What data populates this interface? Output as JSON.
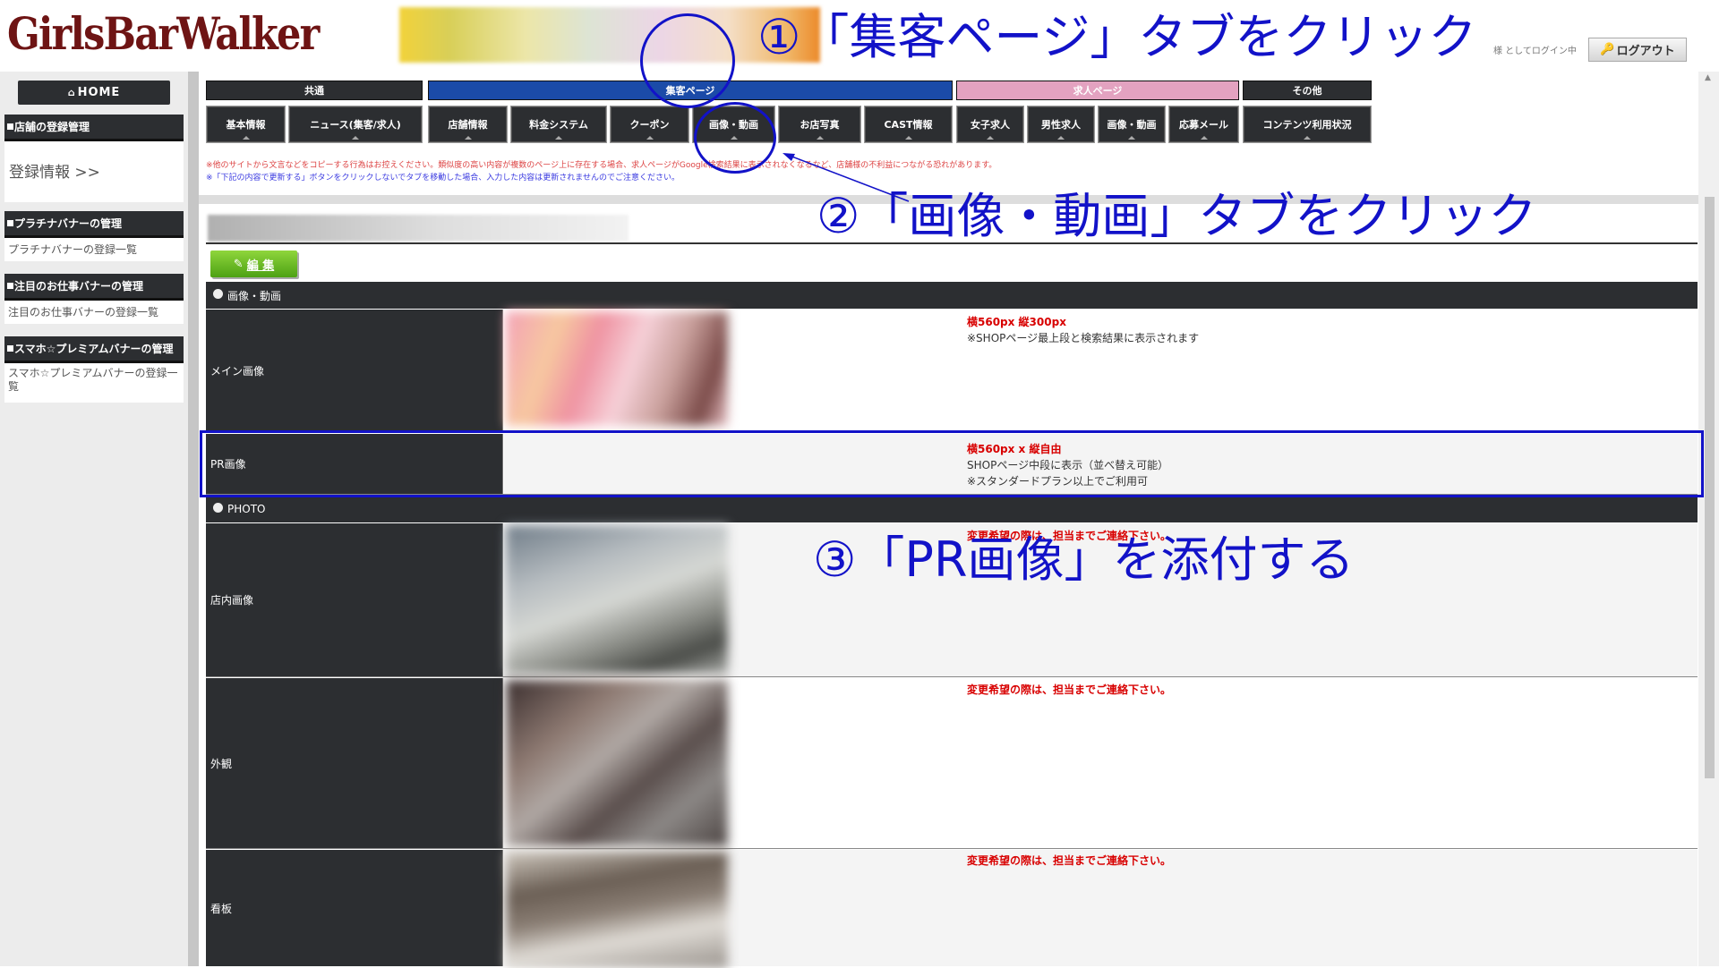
{
  "header": {
    "logo": "GirlsBarWalker",
    "login_text": "様 としてログイン中",
    "logout_label": "ログアウト"
  },
  "sidebar": {
    "home": "HOME",
    "sections": [
      {
        "title": "店舗の登録管理",
        "link": "登録情報 >>"
      },
      {
        "title": "プラチナバナーの管理",
        "link": "プラチナバナーの登録一覧"
      },
      {
        "title": "注目のお仕事バナーの管理",
        "link": "注目のお仕事バナーの登録一覧"
      },
      {
        "title": "スマホ☆プレミアムバナーの管理",
        "link": "スマホ☆プレミアムバナーの登録一覧"
      }
    ]
  },
  "tabs": {
    "groups": [
      {
        "label": "共通",
        "color": "#2c2e31"
      },
      {
        "label": "集客ページ",
        "color": "#1b4ba8"
      },
      {
        "label": "求人ページ",
        "color": "#e3a2c0"
      },
      {
        "label": "その他",
        "color": "#2c2e31"
      }
    ],
    "items": [
      "基本情報",
      "ニュース(集客/求人)",
      "店舗情報",
      "料金システム",
      "クーポン",
      "画像・動画",
      "お店写真",
      "CAST情報",
      "女子求人",
      "男性求人",
      "画像・動画",
      "応募メール",
      "コンテンツ利用状況"
    ]
  },
  "notices": {
    "line1": "※他のサイトから文言などをコピーする行為はお控えください。類似度の高い内容が複数のページ上に存在する場合、求人ページがGoogle検索結果に表示されなくなるなど、店舗様の不利益につながる恐れがあります。",
    "line2": "※「下記の内容で更新する」ボタンをクリックしないでタブを移動した場合、入力した内容は更新されませんのでご注意ください。"
  },
  "content": {
    "edit_label": "編 集",
    "sections": [
      {
        "title": "画像・動画"
      },
      {
        "title": "PHOTO"
      }
    ],
    "rows": [
      {
        "label": "メイン画像",
        "note_red": "横560px 縦300px",
        "note": "※SHOPページ最上段と検索結果に表示されます"
      },
      {
        "label": "PR画像",
        "note_red": "横560px x 縦自由",
        "note": "SHOPページ中段に表示（並べ替え可能）",
        "note2": "※スタンダードプラン以上でご利用可"
      },
      {
        "label": "店内画像",
        "note_red": "変更希望の際は、担当までご連絡下さい。"
      },
      {
        "label": "外観",
        "note_red": "変更希望の際は、担当までご連絡下さい。"
      },
      {
        "label": "看板",
        "note_red": "変更希望の際は、担当までご連絡下さい。"
      }
    ]
  },
  "annotations": {
    "step1": "①「集客ページ」タブをクリック",
    "step2": "②「画像・動画」タブをクリック",
    "step3": "③「PR画像」を添付する",
    "color": "#1212c8"
  }
}
